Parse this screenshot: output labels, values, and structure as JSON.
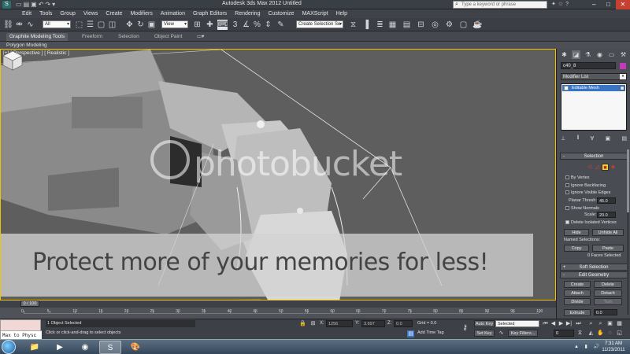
{
  "window": {
    "app_icon": "max-logo-icon",
    "title": "Autodesk 3ds Max 2012    Untitled",
    "search_placeholder": "Type a keyword or phrase",
    "controls": [
      "–",
      "□",
      "✕"
    ]
  },
  "menu": [
    "Edit",
    "Tools",
    "Group",
    "Views",
    "Create",
    "Modifiers",
    "Animation",
    "Graph Editors",
    "Rendering",
    "Customize",
    "MAXScript",
    "Help"
  ],
  "toolbar": {
    "selection_filter": "All",
    "ref_coord": "View",
    "named_selection": "Create Selection Se"
  },
  "ribbon": {
    "tabs": [
      "Graphite Modeling Tools",
      "Freeform",
      "Selection",
      "Object Paint"
    ],
    "active_panel": "Polygon Modeling"
  },
  "viewport": {
    "label": "[+] [ Perspective ] [ Realistic ]",
    "watermark": "photobucket",
    "promo": "Protect more of your memories for less!"
  },
  "command_panel": {
    "object_name": "c40_8",
    "modifier_list": "Modifier List",
    "stack_item": "Editable Mesh",
    "selection_rollout": "Selection",
    "by_vertex": "By Vertex",
    "ignore_backfacing": "Ignore Backfacing",
    "ignore_visible_edges": "Ignore Visible Edges",
    "planar_thresh_label": "Planar Thresh:",
    "planar_thresh_value": "45.0",
    "show_normals": "Show Normals",
    "scale_label": "Scale:",
    "scale_value": "20.0",
    "delete_isolated": "Delete Isolated Vertices",
    "hide": "Hide",
    "unhide_all": "Unhide All",
    "named_selections": "Named Selections:",
    "copy": "Copy",
    "paste": "Paste",
    "faces_selected": "0 Faces Selected",
    "soft_selection": "Soft Selection",
    "edit_geometry": "Edit Geometry",
    "create": "Create",
    "delete": "Delete",
    "attach": "Attach",
    "detach": "Detach",
    "divide": "Divide",
    "turn": "Turn",
    "extrude_label": "Extrude",
    "extrude_value": "0.0",
    "minus": "-",
    "plus": "+"
  },
  "timeline": {
    "slider": "0 / 100",
    "ticks": [
      "0",
      "5",
      "10",
      "15",
      "20",
      "25",
      "30",
      "35",
      "40",
      "45",
      "50",
      "55",
      "60",
      "65",
      "70",
      "75",
      "80",
      "85",
      "90",
      "95",
      "100"
    ]
  },
  "status": {
    "maxscript_listener": "Max to Physc",
    "selected": "1 Object Selected",
    "prompt": "Click or click-and-drag to select objects",
    "x_label": "X:",
    "x_value": "1256",
    "y_label": "Y:",
    "y_value": "3.697",
    "z_label": "Z:",
    "z_value": "0.0",
    "grid": "Grid = 0.0",
    "add_time_tag": "Add Time Tag",
    "auto_key": "Auto Key",
    "selected_dropdown": "Selected",
    "set_key": "Set Key",
    "key_filters": "Key Filters...",
    "frame": "0"
  },
  "taskbar": {
    "time": "7:31 AM",
    "date": "11/23/2011"
  },
  "colors": {
    "active_viewport_border": "#f2c200",
    "object_color": "#c23ab8",
    "stack_highlight": "#3a74c4"
  }
}
